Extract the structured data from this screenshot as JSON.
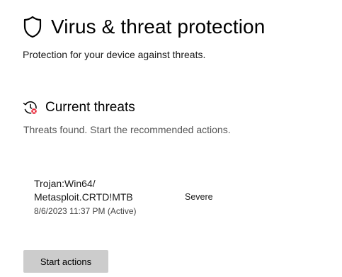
{
  "header": {
    "icon": "shield-icon",
    "title": "Virus & threat protection",
    "subtitle": "Protection for your device against threats."
  },
  "current_threats": {
    "icon": "threat-history-icon",
    "title": "Current threats",
    "status": "Threats found. Start the recommended actions.",
    "threats": [
      {
        "name": "Trojan:Win64/\nMetasploit.CRTD!MTB",
        "date": "8/6/2023 11:37 PM (Active)",
        "severity": "Severe"
      }
    ],
    "action_button_label": "Start actions"
  },
  "colors": {
    "severity_badge": "#e81123",
    "button_background": "#cccccc",
    "muted_text": "#555555"
  }
}
